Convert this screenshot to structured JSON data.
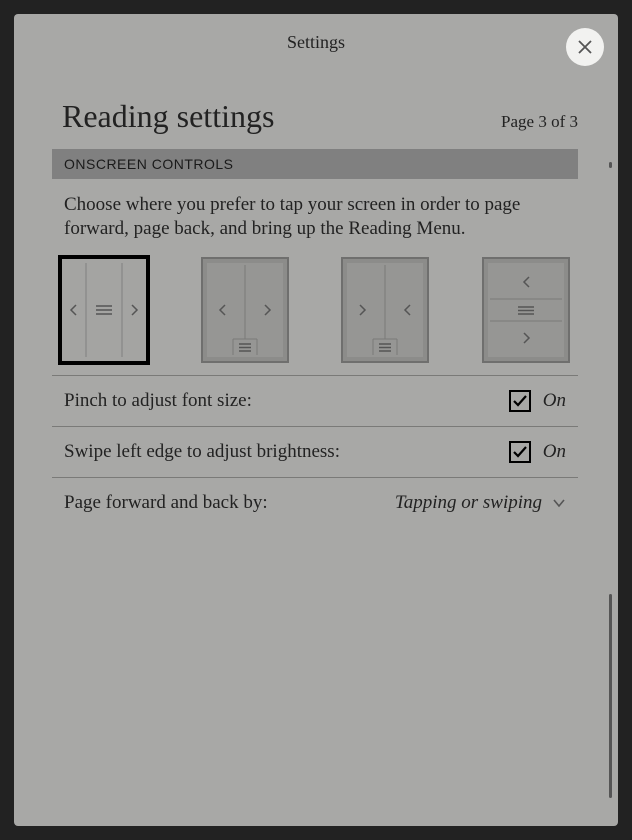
{
  "header": {
    "title": "Settings"
  },
  "page": {
    "title": "Reading settings",
    "indicator": "Page 3 of 3"
  },
  "section": {
    "header": "ONSCREEN CONTROLS",
    "description": "Choose where you prefer to tap your screen in order to page forward, page back, and bring up the Reading Menu."
  },
  "settings": {
    "pinch": {
      "label": "Pinch to adjust font size:",
      "state": "On"
    },
    "brightness": {
      "label": "Swipe left edge to adjust brightness:",
      "state": "On"
    },
    "pageforward": {
      "label": "Page forward and back by:",
      "value": "Tapping or swiping"
    }
  }
}
